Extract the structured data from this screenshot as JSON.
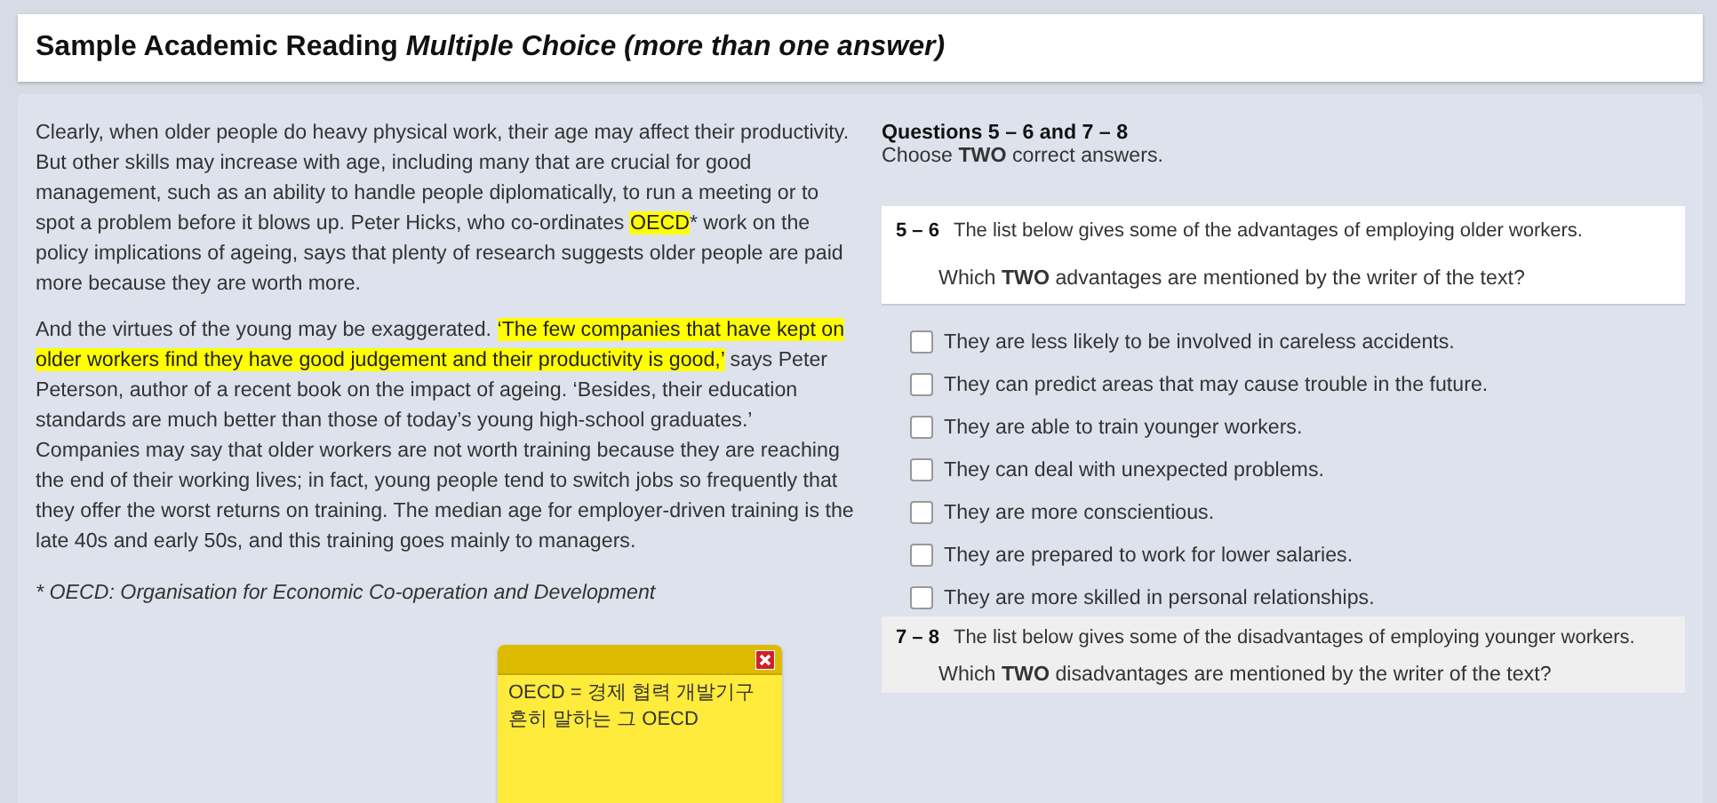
{
  "title": "Sample Academic Reading *Multiple Choice (more than one answer)*",
  "passage": [
    {
      "segments": [
        {
          "text": "Clearly, when older people do heavy physical work, their age may affect their productivity. But other skills may increase with age, including many that are crucial for good management, such as an ability to handle people diplomatically, to run a meeting or to spot a problem before it blows up. Peter Hicks, who co-ordinates ",
          "highlighted": false
        },
        {
          "text": "OECD",
          "highlighted": true
        },
        {
          "text": "* work on the policy implications of ageing, says that plenty of research suggests older people are paid more because they are worth more.",
          "highlighted": false
        }
      ]
    },
    {
      "segments": [
        {
          "text": "And the virtues of the young may be exaggerated. ",
          "highlighted": false
        },
        {
          "text": "‘The few companies that have kept on older workers find they have good judgement and their productivity is good,’",
          "highlighted": true
        },
        {
          "text": " says Peter Peterson, author of a recent book on the impact of ageing. ‘Besides, their education standards are much better than those of today’s young high-school graduates.’ Companies may say that older workers are not worth training because they are reaching the end of their working lives; in fact, young people tend to switch jobs so frequently that they offer the worst returns on training. The median age for employer-driven training is the late 40s and early 50s, and this training goes mainly to managers.",
          "highlighted": false
        }
      ]
    }
  ],
  "footnote": "* OECD: Organisation for Economic Co-operation and Development",
  "note": {
    "text": "OECD = 경제 협력 개발기구\n흔히 말하는 그 OECD"
  },
  "instructions": {
    "heading": "Questions 5 – 6 and 7 – 8",
    "text": "Choose **TWO** correct answers."
  },
  "questions": [
    {
      "number": "5 – 6",
      "stem": "The list below gives some of the advantages of employing older workers.",
      "prompt": "Which **TWO** advantages are mentioned by the writer of the text?",
      "selected": false,
      "options": [
        {
          "label": "They are less likely to be involved in careless accidents.",
          "checked": false
        },
        {
          "label": "They can predict areas that may cause trouble in the future.",
          "checked": false
        },
        {
          "label": "They are able to train younger workers.",
          "checked": false
        },
        {
          "label": "They can deal with unexpected problems.",
          "checked": false
        },
        {
          "label": "They are more conscientious.",
          "checked": false
        },
        {
          "label": "They are prepared to work for lower salaries.",
          "checked": false
        },
        {
          "label": "They are more skilled in personal relationships.",
          "checked": false
        }
      ]
    },
    {
      "number": "7 – 8",
      "stem": "The list below gives some of the disadvantages of employing younger workers.",
      "prompt": "Which **TWO** disadvantages are mentioned by the writer of the text?",
      "selected": true
    }
  ]
}
